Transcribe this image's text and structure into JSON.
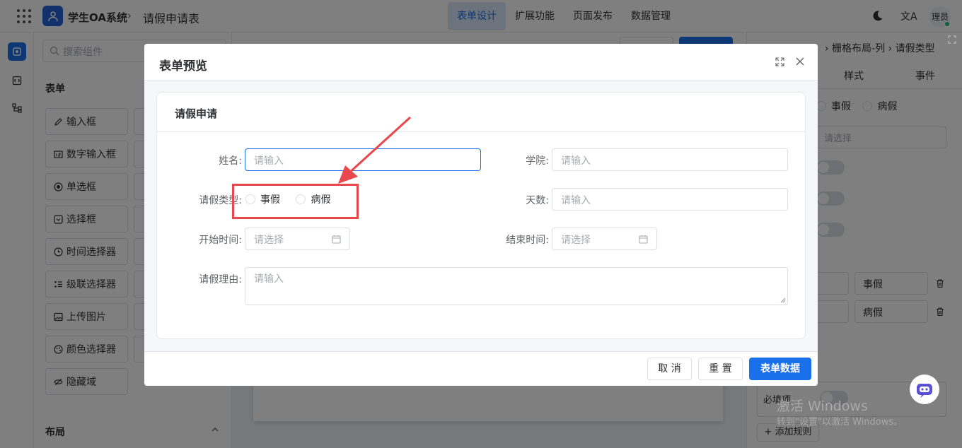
{
  "header": {
    "app_title": "学生OA系统",
    "breadcrumb_sep": "›",
    "page_name": "请假申请表",
    "nav": [
      "表单设计",
      "扩展功能",
      "页面发布",
      "数据管理"
    ],
    "active_nav": "表单设计",
    "lang_glyph": "文A",
    "avatar_text": "理员"
  },
  "components": {
    "search_placeholder": "搜索组件",
    "form_section": "表单",
    "items": [
      "输入框",
      "数字输入框",
      "单选框",
      "选择框",
      "时间选择器",
      "级联选择器",
      "上传图片",
      "颜色选择器",
      "隐藏域"
    ],
    "layout_section": "布局"
  },
  "props": {
    "breadcrumb": "› 栅格布局-列 › 请假类型",
    "tabs": [
      "样式",
      "事件"
    ],
    "radio_options": [
      "事假",
      "病假"
    ],
    "select_placeholder": "请选择",
    "option_values": [
      "事假",
      "病假"
    ],
    "required_label": "必填项",
    "add_rule": "+ 添加规则"
  },
  "watermark": {
    "line1": "激活 Windows",
    "line2": "转到\"设置\"以激活 Windows。"
  },
  "dialog": {
    "title": "表单预览",
    "card_title": "请假申请",
    "fields": {
      "name_label": "姓名:",
      "name_placeholder": "请输入",
      "college_label": "学院:",
      "college_placeholder": "请输入",
      "leave_type_label": "请假类型:",
      "leave_type_options": [
        "事假",
        "病假"
      ],
      "days_label": "天数:",
      "days_placeholder": "请输入",
      "start_label": "开始时间:",
      "start_placeholder": "请选择",
      "end_label": "结束时间:",
      "end_placeholder": "请选择",
      "reason_label": "请假理由:",
      "reason_placeholder": "请输入"
    },
    "buttons": {
      "cancel": "取 消",
      "reset": "重 置",
      "submit": "表单数据"
    }
  },
  "colors": {
    "primary": "#1a6fea",
    "highlight": "#e8474c"
  }
}
